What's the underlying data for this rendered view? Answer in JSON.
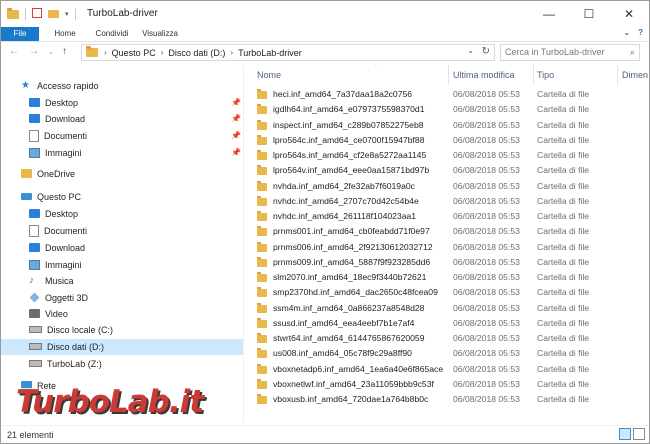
{
  "window": {
    "title": "TurboLab-driver",
    "controls": {
      "minimize": "—",
      "maximize": "☐",
      "close": "✕"
    }
  },
  "ribbon": {
    "tabs": [
      "File",
      "Home",
      "Condividi",
      "Visualizza"
    ],
    "expand_icon": "chevron-down-icon",
    "help_icon": "help-icon"
  },
  "address": {
    "crumbs": [
      "Questo PC",
      "Disco dati (D:)",
      "TurboLab-driver"
    ],
    "search_placeholder": "Cerca in TurboLab-driver"
  },
  "nav": {
    "quick_access": "Accesso rapido",
    "quick_items": [
      "Desktop",
      "Download",
      "Documenti",
      "Immagini"
    ],
    "onedrive": "OneDrive",
    "this_pc": "Questo PC",
    "pc_items": [
      "Desktop",
      "Documenti",
      "Download",
      "Immagini",
      "Musica",
      "Oggetti 3D",
      "Video",
      "Disco locale (C:)",
      "Disco dati (D:)",
      "TurboLab (Z:)"
    ],
    "network": "Rete"
  },
  "columns": {
    "name": "Nome",
    "modified": "Ultima modifica",
    "type": "Tipo",
    "size": "Dimen"
  },
  "files": [
    {
      "name": "heci.inf_amd64_7a37daa18a2c0756",
      "date": "06/08/2018 05:53",
      "type": "Cartella di file"
    },
    {
      "name": "igdlh64.inf_amd64_e0797375598370d1",
      "date": "06/08/2018 05:53",
      "type": "Cartella di file"
    },
    {
      "name": "inspect.inf_amd64_c289b07852275eb8",
      "date": "06/08/2018 05:53",
      "type": "Cartella di file"
    },
    {
      "name": "lpro564c.inf_amd64_ce0700f15947bf88",
      "date": "06/08/2018 05:53",
      "type": "Cartella di file"
    },
    {
      "name": "lpro564s.inf_amd64_cf2e8a5272aa1145",
      "date": "06/08/2018 05:53",
      "type": "Cartella di file"
    },
    {
      "name": "lpro564v.inf_amd64_eee0aa15871bd97b",
      "date": "06/08/2018 05:53",
      "type": "Cartella di file"
    },
    {
      "name": "nvhda.inf_amd64_2fe32ab7f6019a0c",
      "date": "06/08/2018 05:53",
      "type": "Cartella di file"
    },
    {
      "name": "nvhdc.inf_amd64_2707c70d42c54b4e",
      "date": "06/08/2018 05:53",
      "type": "Cartella di file"
    },
    {
      "name": "nvhdc.inf_amd64_261118f104023aa1",
      "date": "06/08/2018 05:53",
      "type": "Cartella di file"
    },
    {
      "name": "prnms001.inf_amd64_cb0feabdd71f0e97",
      "date": "06/08/2018 05:53",
      "type": "Cartella di file"
    },
    {
      "name": "prnms006.inf_amd64_2f92130612032712",
      "date": "06/08/2018 05:53",
      "type": "Cartella di file"
    },
    {
      "name": "prnms009.inf_amd64_5887f9f923285dd6",
      "date": "06/08/2018 05:53",
      "type": "Cartella di file"
    },
    {
      "name": "slm2070.inf_amd64_18ec9f3440b72621",
      "date": "06/08/2018 05:53",
      "type": "Cartella di file"
    },
    {
      "name": "smp2370hd.inf_amd64_dac2650c48fcea09",
      "date": "06/08/2018 05:53",
      "type": "Cartella di file"
    },
    {
      "name": "ssm4m.inf_amd64_0a866237a8548d28",
      "date": "06/08/2018 05:53",
      "type": "Cartella di file"
    },
    {
      "name": "ssusd.inf_amd64_eea4eebf7b1e7af4",
      "date": "06/08/2018 05:53",
      "type": "Cartella di file"
    },
    {
      "name": "stwrt64.inf_amd64_6144765867620059",
      "date": "06/08/2018 05:53",
      "type": "Cartella di file"
    },
    {
      "name": "us008.inf_amd64_05c78f9c29a8ff90",
      "date": "06/08/2018 05:53",
      "type": "Cartella di file"
    },
    {
      "name": "vboxnetadp6.inf_amd64_1ea6a40e6f865ace",
      "date": "06/08/2018 05:53",
      "type": "Cartella di file"
    },
    {
      "name": "vboxnetlwf.inf_amd64_23a11059bbb9c53f",
      "date": "06/08/2018 05:53",
      "type": "Cartella di file"
    },
    {
      "name": "vboxusb.inf_amd64_720dae1a764b8b0c",
      "date": "06/08/2018 05:53",
      "type": "Cartella di file"
    }
  ],
  "status": {
    "count": "21 elementi"
  },
  "watermark": "TurboLab.it",
  "colors": {
    "accent": "#1979ca",
    "selected": "#cce8ff",
    "folder": "#e8b94a",
    "watermark": "#c82a24"
  }
}
